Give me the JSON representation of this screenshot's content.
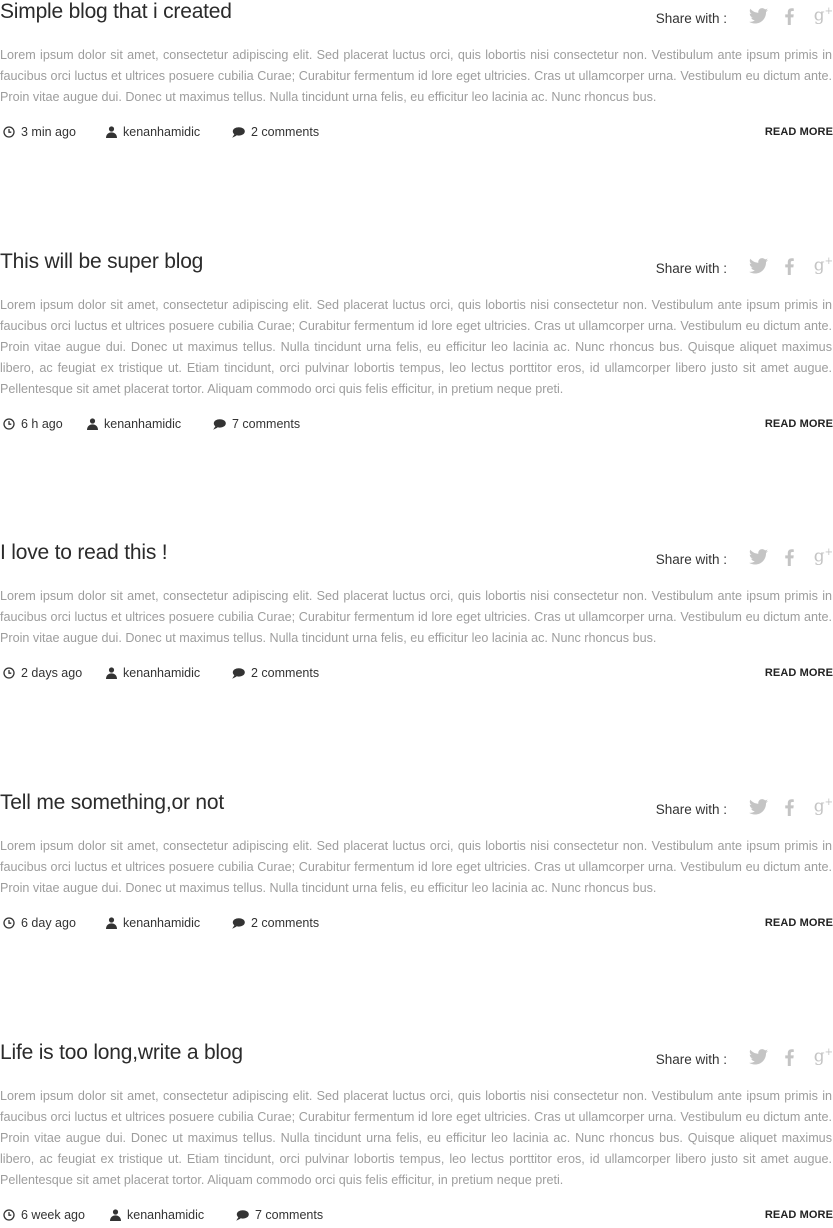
{
  "share_label": "Share with :",
  "read_more_label": "READ MORE",
  "colors": {
    "title": "#2b2b2b",
    "body_text": "#9d9d9d",
    "share_icons": "#c4c4c4",
    "meta_text": "#333333"
  },
  "icons": {
    "time": "clock-icon",
    "author": "user-icon",
    "comments": "comment-bubble-icon",
    "twitter": "twitter-icon",
    "facebook": "facebook-icon",
    "google_plus": "google-plus-icon"
  },
  "posts": [
    {
      "title": "Simple blog that i created",
      "body": "Lorem ipsum dolor sit amet, consectetur adipiscing elit. Sed placerat luctus orci, quis lobortis nisi consectetur non. Vestibulum ante ipsum primis in faucibus orci luctus et ultrices posuere cubilia Curae; Curabitur fermentum id lore eget ultricies. Cras ut ullamcorper urna. Vestibulum eu dictum ante. Proin vitae augue dui. Donec ut maximus tellus. Nulla tincidunt urna felis, eu efficitur leo lacinia ac. Nunc rhoncus bus.",
      "time": "3 min ago",
      "author": "kenanhamidic",
      "comments": "2 comments"
    },
    {
      "title": "This will be super blog",
      "body": "Lorem ipsum dolor sit amet, consectetur adipiscing elit. Sed placerat luctus orci, quis lobortis nisi consectetur non. Vestibulum ante ipsum primis in faucibus orci luctus et ultrices posuere cubilia Curae; Curabitur fermentum id lore eget ultricies. Cras ut ullamcorper urna. Vestibulum eu dictum ante. Proin vitae augue dui. Donec ut maximus tellus. Nulla tincidunt urna felis, eu efficitur leo lacinia ac. Nunc rhoncus bus. Quisque aliquet maximus libero, ac feugiat ex tristique ut. Etiam tincidunt, orci pulvinar lobortis tempus, leo lectus porttitor eros, id ullamcorper libero justo sit amet augue. Pellentesque sit amet placerat tortor. Aliquam commodo orci quis felis efficitur, in pretium neque preti.",
      "time": "6 h ago",
      "author": "kenanhamidic",
      "comments": "7 comments"
    },
    {
      "title": "I love to read this !",
      "body": "Lorem ipsum dolor sit amet, consectetur adipiscing elit. Sed placerat luctus orci, quis lobortis nisi consectetur non. Vestibulum ante ipsum primis in faucibus orci luctus et ultrices posuere cubilia Curae; Curabitur fermentum id lore eget ultricies. Cras ut ullamcorper urna. Vestibulum eu dictum ante. Proin vitae augue dui. Donec ut maximus tellus. Nulla tincidunt urna felis, eu efficitur leo lacinia ac. Nunc rhoncus bus.",
      "time": "2 days ago",
      "author": "kenanhamidic",
      "comments": "2 comments"
    },
    {
      "title": "Tell me something,or not",
      "body": "Lorem ipsum dolor sit amet, consectetur adipiscing elit. Sed placerat luctus orci, quis lobortis nisi consectetur non. Vestibulum ante ipsum primis in faucibus orci luctus et ultrices posuere cubilia Curae; Curabitur fermentum id lore eget ultricies. Cras ut ullamcorper urna. Vestibulum eu dictum ante. Proin vitae augue dui. Donec ut maximus tellus. Nulla tincidunt urna felis, eu efficitur leo lacinia ac. Nunc rhoncus bus.",
      "time": "6 day ago",
      "author": "kenanhamidic",
      "comments": "2 comments"
    },
    {
      "title": "Life is too long,write a blog",
      "body": "Lorem ipsum dolor sit amet, consectetur adipiscing elit. Sed placerat luctus orci, quis lobortis nisi consectetur non. Vestibulum ante ipsum primis in faucibus orci luctus et ultrices posuere cubilia Curae; Curabitur fermentum id lore eget ultricies. Cras ut ullamcorper urna. Vestibulum eu dictum ante. Proin vitae augue dui. Donec ut maximus tellus. Nulla tincidunt urna felis, eu efficitur leo lacinia ac. Nunc rhoncus bus. Quisque aliquet maximus libero, ac feugiat ex tristique ut. Etiam tincidunt, orci pulvinar lobortis tempus, leo lectus porttitor eros, id ullamcorper libero justo sit amet augue. Pellentesque sit amet placerat tortor. Aliquam commodo orci quis felis efficitur, in pretium neque preti.",
      "time": "6 week ago",
      "author": "kenanhamidic",
      "comments": "7 comments"
    }
  ]
}
